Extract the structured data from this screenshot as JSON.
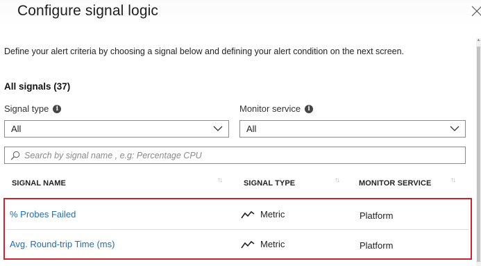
{
  "panel": {
    "title": "Configure signal logic",
    "close_icon": "close-icon"
  },
  "description": "Define your alert criteria by choosing a signal below and defining your alert condition on the next screen.",
  "all_signals_label": "All signals (37)",
  "filters": {
    "signal_type": {
      "label": "Signal type",
      "value": "All",
      "icon": "info-icon"
    },
    "monitor_service": {
      "label": "Monitor service",
      "value": "All",
      "icon": "info-icon"
    }
  },
  "search": {
    "placeholder": "Search by signal name , e.g: Percentage CPU",
    "value": ""
  },
  "table": {
    "columns": [
      "SIGNAL NAME",
      "SIGNAL TYPE",
      "MONITOR SERVICE"
    ],
    "rows": [
      {
        "name": "% Probes Failed",
        "type": "Metric",
        "service": "Platform"
      },
      {
        "name": "Avg. Round-trip Time (ms)",
        "type": "Metric",
        "service": "Platform"
      }
    ]
  },
  "colors": {
    "link": "#1f6db5",
    "highlight_border": "#d0202e"
  }
}
